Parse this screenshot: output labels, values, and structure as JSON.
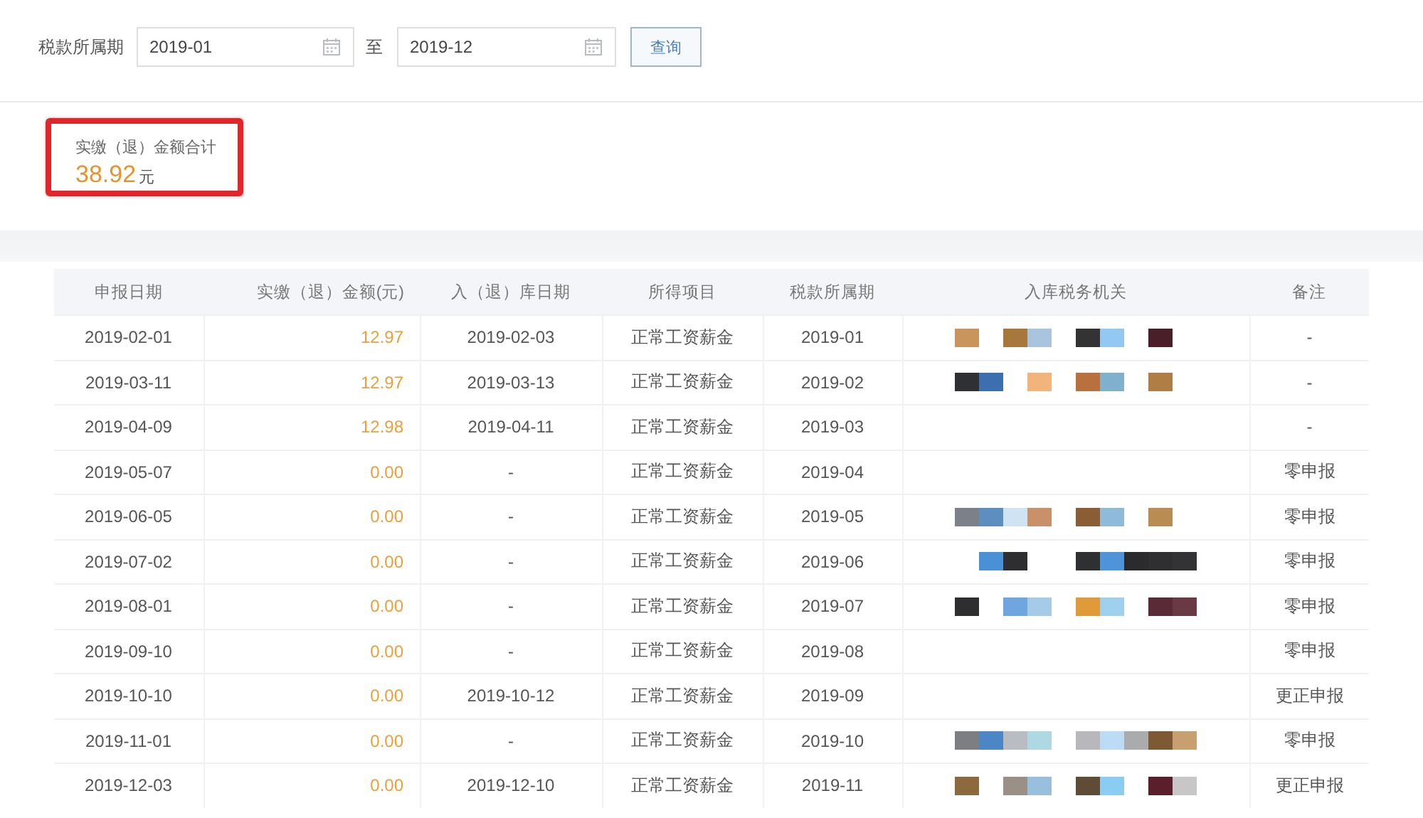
{
  "filter": {
    "label": "税款所属期",
    "start": {
      "value": "2019-01"
    },
    "separator": "至",
    "end": {
      "value": "2019-12"
    },
    "button": "查询"
  },
  "summary": {
    "highlighted": true,
    "label": "实缴（退）金额合计",
    "amount": "38.92",
    "unit": "元"
  },
  "table": {
    "columns": [
      "申报日期",
      "实缴（退）金额(元)",
      "入（退）库日期",
      "所得项目",
      "税款所属期",
      "入库税务机关",
      "备注"
    ],
    "rows": [
      {
        "declared": "2019-02-01",
        "amount": "12.97",
        "stored": "2019-02-03",
        "item": "正常工资薪金",
        "period": "2019-01",
        "redacted": true,
        "note": "-"
      },
      {
        "declared": "2019-03-11",
        "amount": "12.97",
        "stored": "2019-03-13",
        "item": "正常工资薪金",
        "period": "2019-02",
        "redacted": true,
        "note": "-"
      },
      {
        "declared": "2019-04-09",
        "amount": "12.98",
        "stored": "2019-04-11",
        "item": "正常工资薪金",
        "period": "2019-03",
        "redacted": false,
        "note": "-"
      },
      {
        "declared": "2019-05-07",
        "amount": "0.00",
        "stored": "-",
        "item": "正常工资薪金",
        "period": "2019-04",
        "redacted": false,
        "note": "零申报"
      },
      {
        "declared": "2019-06-05",
        "amount": "0.00",
        "stored": "-",
        "item": "正常工资薪金",
        "period": "2019-05",
        "redacted": true,
        "note": "零申报"
      },
      {
        "declared": "2019-07-02",
        "amount": "0.00",
        "stored": "-",
        "item": "正常工资薪金",
        "period": "2019-06",
        "redacted": true,
        "note": "零申报"
      },
      {
        "declared": "2019-08-01",
        "amount": "0.00",
        "stored": "-",
        "item": "正常工资薪金",
        "period": "2019-07",
        "redacted": true,
        "note": "零申报"
      },
      {
        "declared": "2019-09-10",
        "amount": "0.00",
        "stored": "-",
        "item": "正常工资薪金",
        "period": "2019-08",
        "redacted": false,
        "note": "零申报"
      },
      {
        "declared": "2019-10-10",
        "amount": "0.00",
        "stored": "2019-10-12",
        "item": "正常工资薪金",
        "period": "2019-09",
        "redacted": false,
        "note": "更正申报"
      },
      {
        "declared": "2019-11-01",
        "amount": "0.00",
        "stored": "-",
        "item": "正常工资薪金",
        "period": "2019-10",
        "redacted": true,
        "note": "零申报"
      },
      {
        "declared": "2019-12-03",
        "amount": "0.00",
        "stored": "2019-12-10",
        "item": "正常工资薪金",
        "period": "2019-11",
        "redacted": true,
        "note": "更正申报"
      }
    ]
  }
}
